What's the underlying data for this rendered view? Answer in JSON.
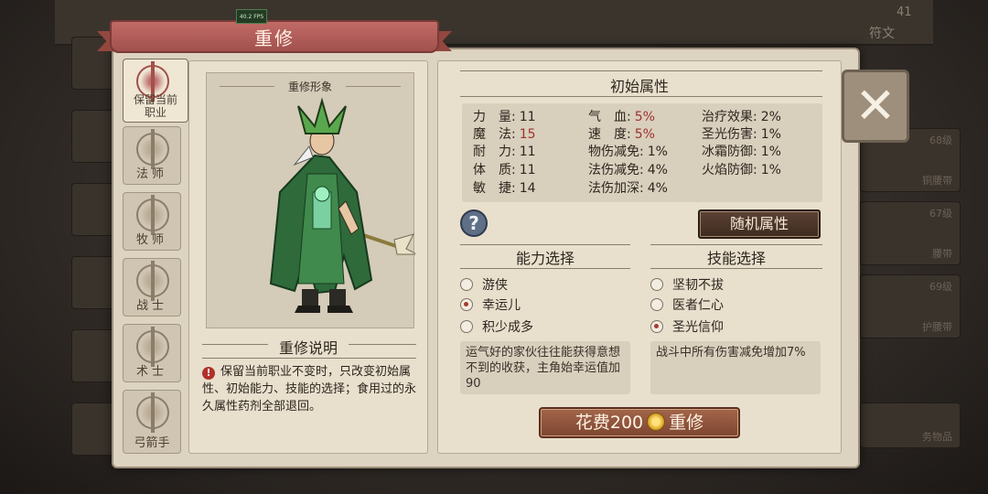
{
  "fps": "40.2 FPS",
  "background": {
    "top_label": "符文",
    "top_count": "41",
    "right_labels": [
      "68级",
      "铜腰带",
      "67级",
      "腰带",
      "69级",
      "护腰带",
      "务物品"
    ]
  },
  "dialog": {
    "title": "重修",
    "close_label": "✕"
  },
  "tabs": [
    {
      "label": "保留当前职业",
      "active": true
    },
    {
      "label": "法师",
      "active": false
    },
    {
      "label": "牧师",
      "active": false
    },
    {
      "label": "战士",
      "active": false
    },
    {
      "label": "术士",
      "active": false
    },
    {
      "label": "弓箭手",
      "active": false
    }
  ],
  "portrait": {
    "title": "重修形象"
  },
  "description": {
    "title": "重修说明",
    "text": "保留当前职业不变时，只改变初始属性、初始能力、技能的选择；食用过的永久属性药剂全部退回。"
  },
  "attributes": {
    "title": "初始属性",
    "col1": [
      {
        "name": "力　量:",
        "value": "11"
      },
      {
        "name": "魔　法:",
        "value": "15"
      },
      {
        "name": "耐　力:",
        "value": "11"
      },
      {
        "name": "体　质:",
        "value": "11"
      },
      {
        "name": "敏　捷:",
        "value": "14"
      }
    ],
    "col2": [
      {
        "name": "气　血:",
        "value": "5%"
      },
      {
        "name": "速　度:",
        "value": "5%"
      },
      {
        "name": "物伤减免:",
        "value": "1%"
      },
      {
        "name": "法伤减免:",
        "value": "4%"
      },
      {
        "name": "法伤加深:",
        "value": "4%"
      }
    ],
    "col3": [
      {
        "name": "治疗效果:",
        "value": "2%"
      },
      {
        "name": "圣光伤害:",
        "value": "1%"
      },
      {
        "name": "冰霜防御:",
        "value": "1%"
      },
      {
        "name": "火焰防御:",
        "value": "1%"
      }
    ],
    "highlight_color": "#a0322c"
  },
  "help_label": "?",
  "random_button": "随机属性",
  "ability": {
    "title": "能力选择",
    "options": [
      {
        "label": "游侠",
        "selected": false
      },
      {
        "label": "幸运儿",
        "selected": true
      },
      {
        "label": "积少成多",
        "selected": false
      }
    ],
    "info": "运气好的家伙往往能获得意想不到的收获，主角始幸运值加90"
  },
  "skill": {
    "title": "技能选择",
    "options": [
      {
        "label": "坚韧不拔",
        "selected": false
      },
      {
        "label": "医者仁心",
        "selected": false
      },
      {
        "label": "圣光信仰",
        "selected": true
      }
    ],
    "info": "战斗中所有伤害减免增加7%"
  },
  "cost_button": {
    "prefix": "花费200",
    "suffix": "重修"
  }
}
